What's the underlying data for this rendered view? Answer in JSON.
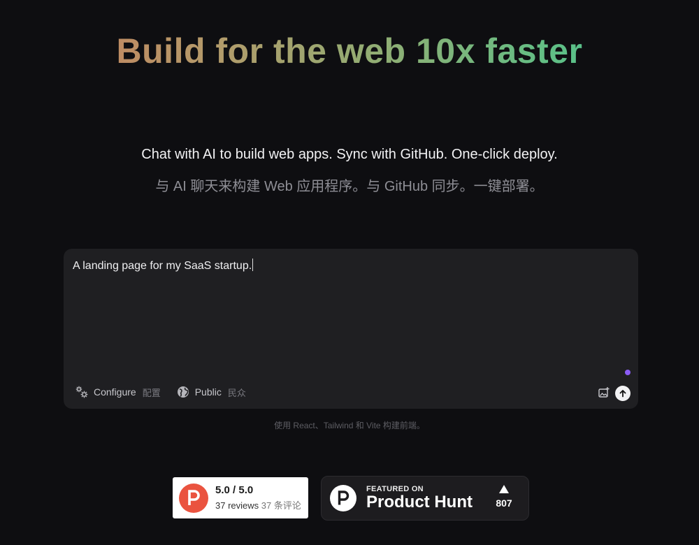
{
  "hero": {
    "title": "Build for the web 10x faster",
    "subtitle_en": "Chat with AI to build web apps. Sync with GitHub. One-click deploy.",
    "subtitle_zh": "与 AI 聊天来构建 Web 应用程序。与 GitHub 同步。一键部署。"
  },
  "prompt": {
    "value": "A landing page for my SaaS startup.",
    "status_dot_color": "#8b5cf6"
  },
  "toolbar": {
    "configure_label": "Configure",
    "configure_label_zh": "配置",
    "public_label": "Public",
    "public_label_zh": "民众"
  },
  "footer_note": "使用 React、Tailwind 和 Vite 构建前端。",
  "rating_badge": {
    "score": "5.0 / 5.0",
    "reviews": "37 reviews",
    "reviews_zh": "37 条评论",
    "logo_letter": "P",
    "accent": "#ea533f"
  },
  "product_hunt": {
    "featured": "FEATURED ON",
    "name": "Product Hunt",
    "votes": "807",
    "logo_letter": "P"
  },
  "icons": {
    "configure": "gears-icon",
    "public": "globe-icon",
    "image": "image-upload-icon",
    "send": "arrow-up-icon"
  }
}
